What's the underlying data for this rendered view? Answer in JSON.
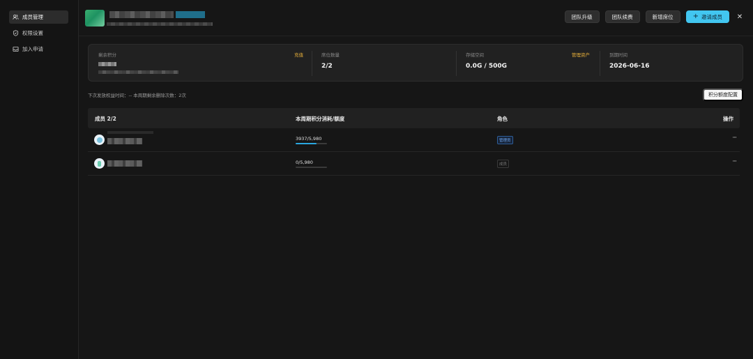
{
  "sidebar": {
    "items": [
      {
        "label": "成员管理",
        "icon": "users-icon",
        "active": true
      },
      {
        "label": "权限设置",
        "icon": "shield-icon",
        "active": false
      },
      {
        "label": "加入申请",
        "icon": "inbox-icon",
        "active": false
      }
    ]
  },
  "header": {
    "buttons": {
      "upgrade": "团队升级",
      "renew": "团队续费",
      "add_seat": "新增席位",
      "invite": "邀请成员"
    }
  },
  "stats": {
    "points": {
      "label": "剩余积分",
      "action": "充值"
    },
    "seats": {
      "label": "席位数量",
      "value": "2/2"
    },
    "storage": {
      "label": "存储空间",
      "value": "0.0G / 500G",
      "action": "管理资产"
    },
    "expiry": {
      "label": "到期时间",
      "value": "2026-06-16"
    }
  },
  "note": "下次发放权益时间：-- 本周期剩余删除次数：2次",
  "quota_button": "积分额度配置",
  "table": {
    "headers": {
      "member": "成员 2/2",
      "usage": "本周期积分消耗/额度",
      "role": "角色",
      "actions": "操作"
    },
    "rows": [
      {
        "usage": "3937/5,980",
        "usage_fraction": 0.66,
        "role": "管理员",
        "more": "···"
      },
      {
        "usage": "0/5,980",
        "usage_fraction": 0,
        "role": "成员",
        "more": "···"
      }
    ]
  },
  "colors": {
    "accent": "#42c6f0",
    "link": "#e9b13a",
    "admin_badge": "#6fa8f0"
  }
}
